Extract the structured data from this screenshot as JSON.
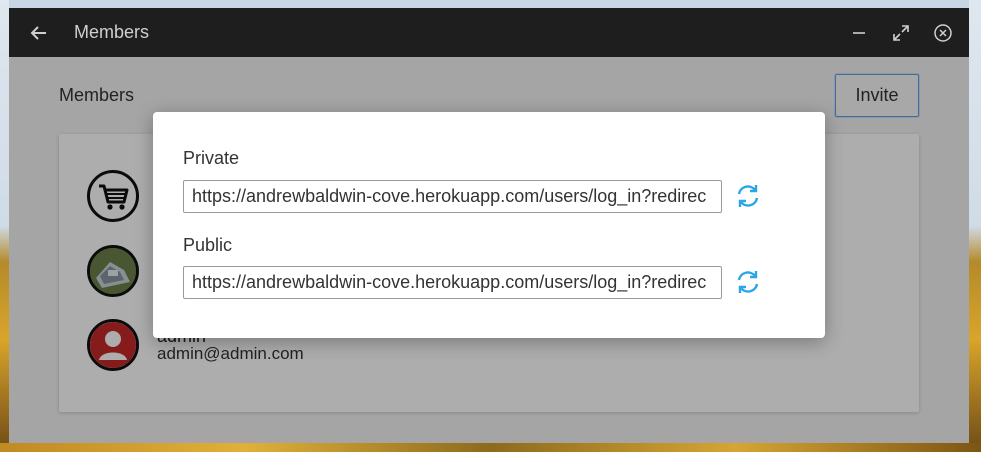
{
  "window": {
    "title": "Members"
  },
  "page": {
    "heading": "Members",
    "invite_label": "Invite"
  },
  "members": [
    {
      "name": "",
      "email": "",
      "avatar": "cart-icon"
    },
    {
      "name": "",
      "email": "",
      "avatar": "photo-avatar"
    },
    {
      "name": "admin",
      "email": "admin@admin.com",
      "avatar": "user-icon"
    }
  ],
  "invite_dialog": {
    "private_label": "Private",
    "private_url": "https://andrewbaldwin-cove.herokuapp.com/users/log_in?redirec",
    "public_label": "Public",
    "public_url": "https://andrewbaldwin-cove.herokuapp.com/users/log_in?redirec"
  },
  "colors": {
    "titlebar": "#1e1e1e",
    "accent": "#2aa6e6",
    "user_avatar": "#c62828"
  }
}
